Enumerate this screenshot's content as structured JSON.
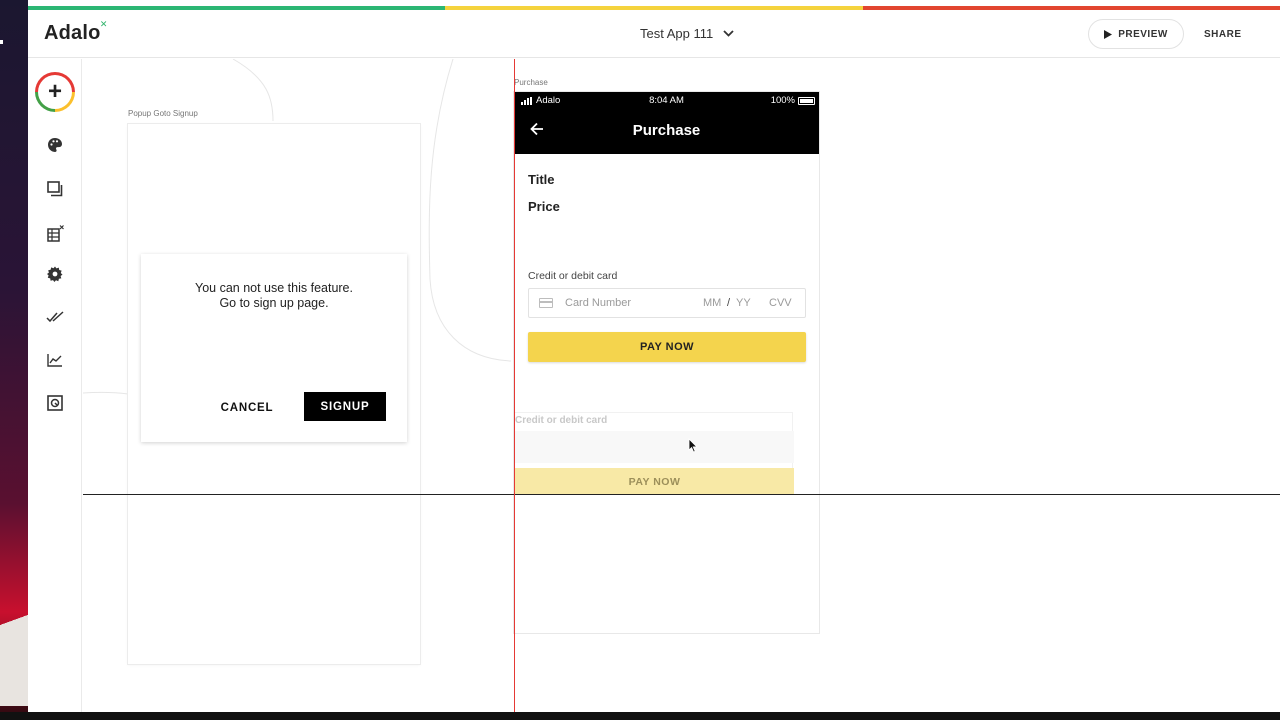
{
  "header": {
    "logo": "Adalo",
    "app_name": "Test App 111",
    "preview_label": "PREVIEW",
    "share_label": "SHARE",
    "accent_colors": [
      "#2bb673",
      "#f5d33d",
      "#e2452f"
    ]
  },
  "sidebar": {
    "items": [
      {
        "icon": "add-icon",
        "glyph": "+"
      },
      {
        "icon": "palette-icon"
      },
      {
        "icon": "screens-icon"
      },
      {
        "icon": "database-icon"
      },
      {
        "icon": "gear-icon"
      },
      {
        "icon": "double-check-icon"
      },
      {
        "icon": "analytics-icon"
      },
      {
        "icon": "publish-icon"
      }
    ]
  },
  "popup_screen": {
    "label": "Popup Goto Signup",
    "message_line1": "You can not use this feature.",
    "message_line2": "Go to sign up page.",
    "cancel_label": "CANCEL",
    "signup_label": "SIGNUP"
  },
  "purchase_screen": {
    "label": "Purchase",
    "status": {
      "carrier": "Adalo",
      "time": "8:04 AM",
      "battery": "100%"
    },
    "nav_title": "Purchase",
    "title_label": "Title",
    "price_label": "Price",
    "card_label": "Credit or debit card",
    "card_number_placeholder": "Card Number",
    "mm": "MM",
    "slash": "/",
    "yy": "YY",
    "cvv": "CVV",
    "pay_label": "PAY NOW",
    "pay_color": "#f4d44d"
  },
  "ghost_component": {
    "card_label": "Credit or debit card",
    "pay_label": "PAY NOW"
  }
}
